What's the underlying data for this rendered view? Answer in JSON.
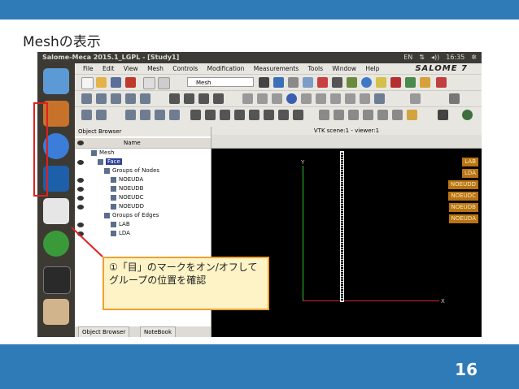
{
  "slide": {
    "title": "Meshの表示",
    "page_number": "16"
  },
  "window": {
    "title": "Salome-Meca 2015.1_LGPL - [Study1]",
    "tray": [
      "EN",
      "⇅",
      "◂))",
      "16:35",
      "✲"
    ],
    "brand": "SALOME 7"
  },
  "menu": [
    "File",
    "Edit",
    "View",
    "Mesh",
    "Controls",
    "Modification",
    "Measurements",
    "Tools",
    "Window",
    "Help"
  ],
  "toolbar": {
    "mesh_combo": "Mesh"
  },
  "object_browser": {
    "title": "Object Browser",
    "column_name": "Name",
    "tree": [
      {
        "label": "Mesh",
        "level": 0,
        "eye": false
      },
      {
        "label": "Face",
        "level": 1,
        "eye": true,
        "selected": true
      },
      {
        "label": "Groups of Nodes",
        "level": 2,
        "eye": false
      },
      {
        "label": "NOEUDA",
        "level": 3,
        "eye": true
      },
      {
        "label": "NOEUDB",
        "level": 3,
        "eye": true
      },
      {
        "label": "NOEUDC",
        "level": 3,
        "eye": true
      },
      {
        "label": "NOEUDD",
        "level": 3,
        "eye": true
      },
      {
        "label": "Groups of Edges",
        "level": 2,
        "eye": false
      },
      {
        "label": "LAB",
        "level": 3,
        "eye": true
      },
      {
        "label": "LDA",
        "level": 3,
        "eye": true
      }
    ],
    "tabs": [
      "Object Browser",
      "NoteBook"
    ]
  },
  "viewer": {
    "title": "VTK scene:1 - viewer:1",
    "group_labels": [
      "LAB",
      "LDA",
      "NOEUDD",
      "NOEUDC",
      "NOEUDB",
      "NOEUDA"
    ],
    "axis_y": "Y",
    "axis_x": "X"
  },
  "callout": {
    "text": "①「目」のマークをオン/オフしてグループの位置を確認"
  },
  "colors": {
    "slide_bar": "#2f7bb8",
    "callout_border": "#f0a030",
    "highlight_box": "#e02020",
    "group_label_bg": "#b97414"
  }
}
